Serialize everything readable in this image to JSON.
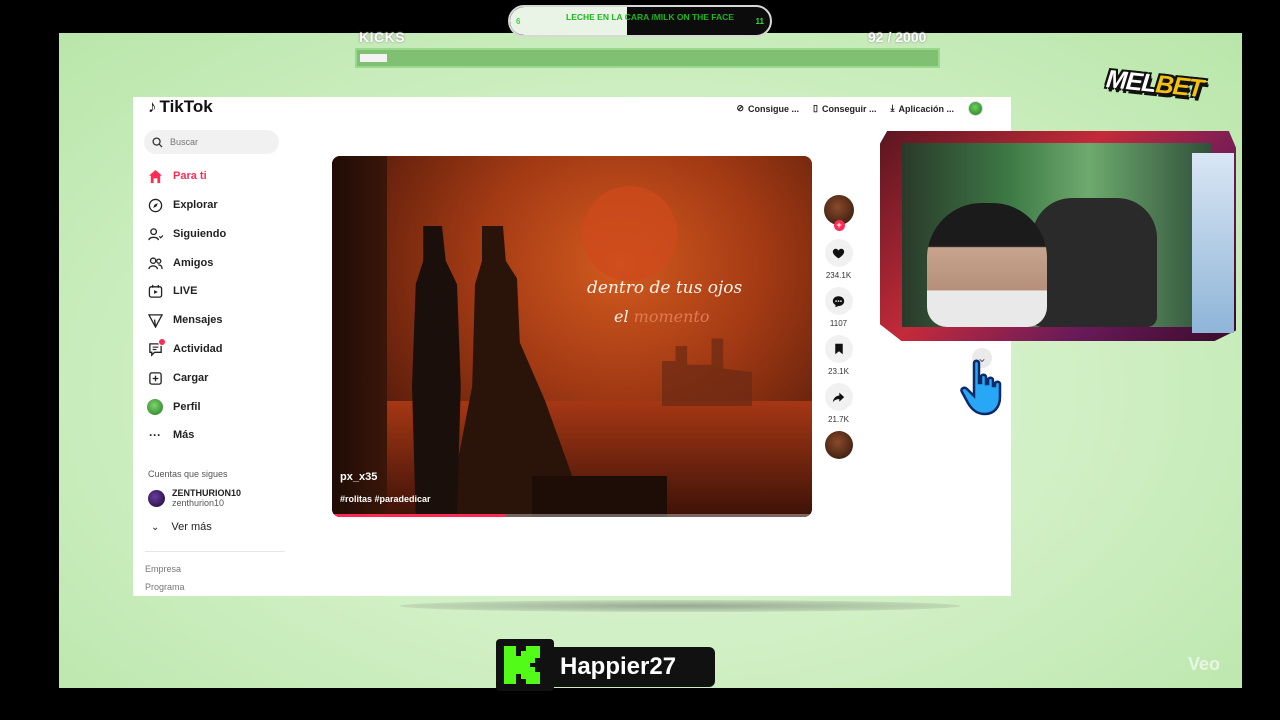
{
  "goal": {
    "left_value": "6",
    "title": "LECHE EN LA CARA /MILK ON THE FACE",
    "right_value": "11",
    "progress_fraction": 0.45
  },
  "kicks": {
    "label": "KICKS",
    "count": "92   / 2000",
    "progress_fraction": 0.046
  },
  "tiktok": {
    "logo": "TikTok",
    "search": {
      "placeholder": "Buscar"
    },
    "nav": [
      {
        "label": "Para ti",
        "icon": "home-icon",
        "active": true
      },
      {
        "label": "Explorar",
        "icon": "compass-icon"
      },
      {
        "label": "Siguiendo",
        "icon": "following-icon"
      },
      {
        "label": "Amigos",
        "icon": "friends-icon"
      },
      {
        "label": "LIVE",
        "icon": "live-icon"
      },
      {
        "label": "Mensajes",
        "icon": "messages-icon"
      },
      {
        "label": "Actividad",
        "icon": "activity-icon"
      },
      {
        "label": "Cargar",
        "icon": "upload-icon"
      },
      {
        "label": "Perfil",
        "icon": "profile-avatar-icon"
      },
      {
        "label": "Más",
        "icon": "more-icon"
      }
    ],
    "follows_title": "Cuentas que sigues",
    "followed_user": {
      "name": "ZENTHURION10",
      "handle": "zenthurion10"
    },
    "see_more": "Ver más",
    "footer": [
      "Empresa",
      "Programa"
    ],
    "header": {
      "coins": "Consigue ...",
      "get_app": "Conseguir ...",
      "download": "Aplicación ..."
    },
    "video": {
      "quote_line1": "dentro de tus ojos",
      "quote_line2_a": "el ",
      "quote_line2_b": "momento",
      "author": "px_x35",
      "tags": "#rolitas #paradedicar",
      "progress_fraction": 0.36
    },
    "actions": {
      "likes": "234.1K",
      "comments": "1107",
      "saves": "23.1K",
      "shares": "21.7K"
    }
  },
  "sponsor": {
    "mel": "MEL",
    "bet": "BET"
  },
  "streamer": {
    "name": "Happier27"
  },
  "watermark": "Veo",
  "colors": {
    "tiktok_accent": "#fe2c55",
    "kick_green": "#53fc18",
    "overlay_green": "#cfefc3"
  }
}
